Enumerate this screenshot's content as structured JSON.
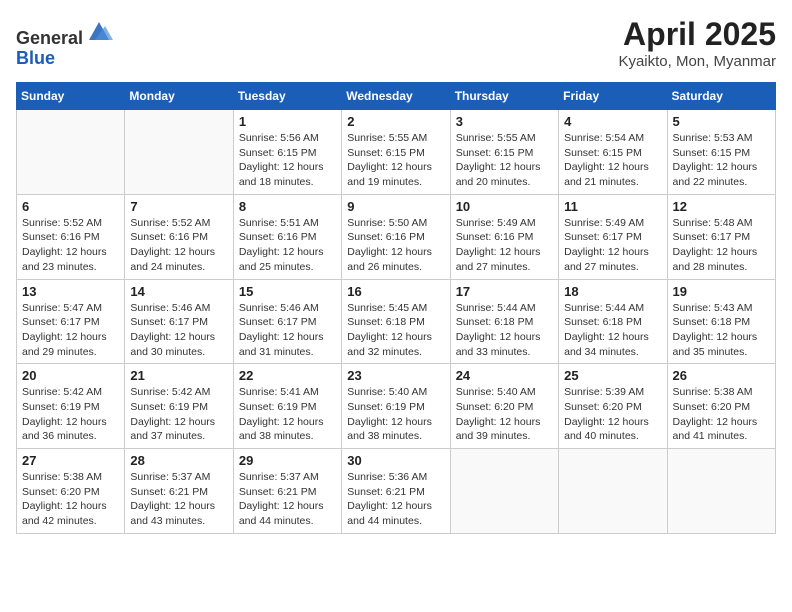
{
  "header": {
    "logo_line1": "General",
    "logo_line2": "Blue",
    "month_title": "April 2025",
    "location": "Kyaikto, Mon, Myanmar"
  },
  "days_of_week": [
    "Sunday",
    "Monday",
    "Tuesday",
    "Wednesday",
    "Thursday",
    "Friday",
    "Saturday"
  ],
  "weeks": [
    [
      {
        "day": "",
        "info": ""
      },
      {
        "day": "",
        "info": ""
      },
      {
        "day": "1",
        "info": "Sunrise: 5:56 AM\nSunset: 6:15 PM\nDaylight: 12 hours and 18 minutes."
      },
      {
        "day": "2",
        "info": "Sunrise: 5:55 AM\nSunset: 6:15 PM\nDaylight: 12 hours and 19 minutes."
      },
      {
        "day": "3",
        "info": "Sunrise: 5:55 AM\nSunset: 6:15 PM\nDaylight: 12 hours and 20 minutes."
      },
      {
        "day": "4",
        "info": "Sunrise: 5:54 AM\nSunset: 6:15 PM\nDaylight: 12 hours and 21 minutes."
      },
      {
        "day": "5",
        "info": "Sunrise: 5:53 AM\nSunset: 6:15 PM\nDaylight: 12 hours and 22 minutes."
      }
    ],
    [
      {
        "day": "6",
        "info": "Sunrise: 5:52 AM\nSunset: 6:16 PM\nDaylight: 12 hours and 23 minutes."
      },
      {
        "day": "7",
        "info": "Sunrise: 5:52 AM\nSunset: 6:16 PM\nDaylight: 12 hours and 24 minutes."
      },
      {
        "day": "8",
        "info": "Sunrise: 5:51 AM\nSunset: 6:16 PM\nDaylight: 12 hours and 25 minutes."
      },
      {
        "day": "9",
        "info": "Sunrise: 5:50 AM\nSunset: 6:16 PM\nDaylight: 12 hours and 26 minutes."
      },
      {
        "day": "10",
        "info": "Sunrise: 5:49 AM\nSunset: 6:16 PM\nDaylight: 12 hours and 27 minutes."
      },
      {
        "day": "11",
        "info": "Sunrise: 5:49 AM\nSunset: 6:17 PM\nDaylight: 12 hours and 27 minutes."
      },
      {
        "day": "12",
        "info": "Sunrise: 5:48 AM\nSunset: 6:17 PM\nDaylight: 12 hours and 28 minutes."
      }
    ],
    [
      {
        "day": "13",
        "info": "Sunrise: 5:47 AM\nSunset: 6:17 PM\nDaylight: 12 hours and 29 minutes."
      },
      {
        "day": "14",
        "info": "Sunrise: 5:46 AM\nSunset: 6:17 PM\nDaylight: 12 hours and 30 minutes."
      },
      {
        "day": "15",
        "info": "Sunrise: 5:46 AM\nSunset: 6:17 PM\nDaylight: 12 hours and 31 minutes."
      },
      {
        "day": "16",
        "info": "Sunrise: 5:45 AM\nSunset: 6:18 PM\nDaylight: 12 hours and 32 minutes."
      },
      {
        "day": "17",
        "info": "Sunrise: 5:44 AM\nSunset: 6:18 PM\nDaylight: 12 hours and 33 minutes."
      },
      {
        "day": "18",
        "info": "Sunrise: 5:44 AM\nSunset: 6:18 PM\nDaylight: 12 hours and 34 minutes."
      },
      {
        "day": "19",
        "info": "Sunrise: 5:43 AM\nSunset: 6:18 PM\nDaylight: 12 hours and 35 minutes."
      }
    ],
    [
      {
        "day": "20",
        "info": "Sunrise: 5:42 AM\nSunset: 6:19 PM\nDaylight: 12 hours and 36 minutes."
      },
      {
        "day": "21",
        "info": "Sunrise: 5:42 AM\nSunset: 6:19 PM\nDaylight: 12 hours and 37 minutes."
      },
      {
        "day": "22",
        "info": "Sunrise: 5:41 AM\nSunset: 6:19 PM\nDaylight: 12 hours and 38 minutes."
      },
      {
        "day": "23",
        "info": "Sunrise: 5:40 AM\nSunset: 6:19 PM\nDaylight: 12 hours and 38 minutes."
      },
      {
        "day": "24",
        "info": "Sunrise: 5:40 AM\nSunset: 6:20 PM\nDaylight: 12 hours and 39 minutes."
      },
      {
        "day": "25",
        "info": "Sunrise: 5:39 AM\nSunset: 6:20 PM\nDaylight: 12 hours and 40 minutes."
      },
      {
        "day": "26",
        "info": "Sunrise: 5:38 AM\nSunset: 6:20 PM\nDaylight: 12 hours and 41 minutes."
      }
    ],
    [
      {
        "day": "27",
        "info": "Sunrise: 5:38 AM\nSunset: 6:20 PM\nDaylight: 12 hours and 42 minutes."
      },
      {
        "day": "28",
        "info": "Sunrise: 5:37 AM\nSunset: 6:21 PM\nDaylight: 12 hours and 43 minutes."
      },
      {
        "day": "29",
        "info": "Sunrise: 5:37 AM\nSunset: 6:21 PM\nDaylight: 12 hours and 44 minutes."
      },
      {
        "day": "30",
        "info": "Sunrise: 5:36 AM\nSunset: 6:21 PM\nDaylight: 12 hours and 44 minutes."
      },
      {
        "day": "",
        "info": ""
      },
      {
        "day": "",
        "info": ""
      },
      {
        "day": "",
        "info": ""
      }
    ]
  ]
}
